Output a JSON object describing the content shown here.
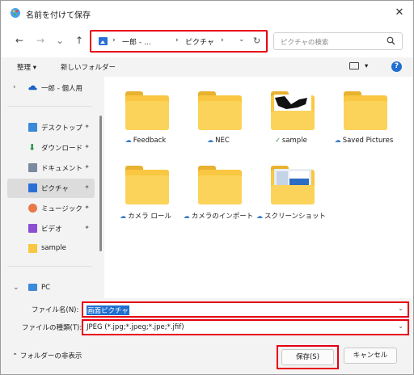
{
  "window": {
    "title": "名前を付けて保存",
    "close": "✕"
  },
  "nav": {
    "back": "←",
    "forward": "→",
    "recent": "⌄",
    "up": "↑",
    "address": [
      "一郎 - ...",
      "ピクチャ"
    ],
    "sep": "›",
    "refresh": "↻",
    "dropdown": "⌄",
    "search_placeholder": "ピクチャの検索"
  },
  "toolbar": {
    "organize": "整理 ▾",
    "new_folder": "新しいフォルダー",
    "view_caret": "▾",
    "help": "?"
  },
  "sidebar": {
    "onedrive": "一郎 - 個人用",
    "items": [
      {
        "label": "デスクトップ",
        "pinned": true
      },
      {
        "label": "ダウンロード",
        "pinned": true
      },
      {
        "label": "ドキュメント",
        "pinned": true
      },
      {
        "label": "ピクチャ",
        "pinned": true,
        "selected": true
      },
      {
        "label": "ミュージック",
        "pinned": true
      },
      {
        "label": "ビデオ",
        "pinned": true
      },
      {
        "label": "sample",
        "pinned": false
      }
    ],
    "pc": "PC",
    "pin": "📌"
  },
  "files": [
    {
      "name": "Feedback",
      "status": "cloud"
    },
    {
      "name": "NEC",
      "status": "cloud"
    },
    {
      "name": "sample",
      "status": "synced"
    },
    {
      "name": "Saved Pictures",
      "status": "cloud"
    },
    {
      "name": "カメラ ロール",
      "status": "cloud"
    },
    {
      "name": "カメラのインポート",
      "status": "cloud"
    },
    {
      "name": "スクリーンショット",
      "status": "cloud"
    }
  ],
  "fields": {
    "filename_label": "ファイル名(N):",
    "filename_value": "画面ピクチャ",
    "filetype_label": "ファイルの種類(T):",
    "filetype_value": "JPEG (*.jpg;*.jpeg;*.jpe;*.jfif)"
  },
  "footer": {
    "hide_folders": "フォルダーの非表示",
    "save": "保存(S)",
    "cancel": "キャンセル"
  },
  "colors": {
    "highlight": "#e60012",
    "accent": "#1f6fd0",
    "folder": "#f9c741"
  }
}
